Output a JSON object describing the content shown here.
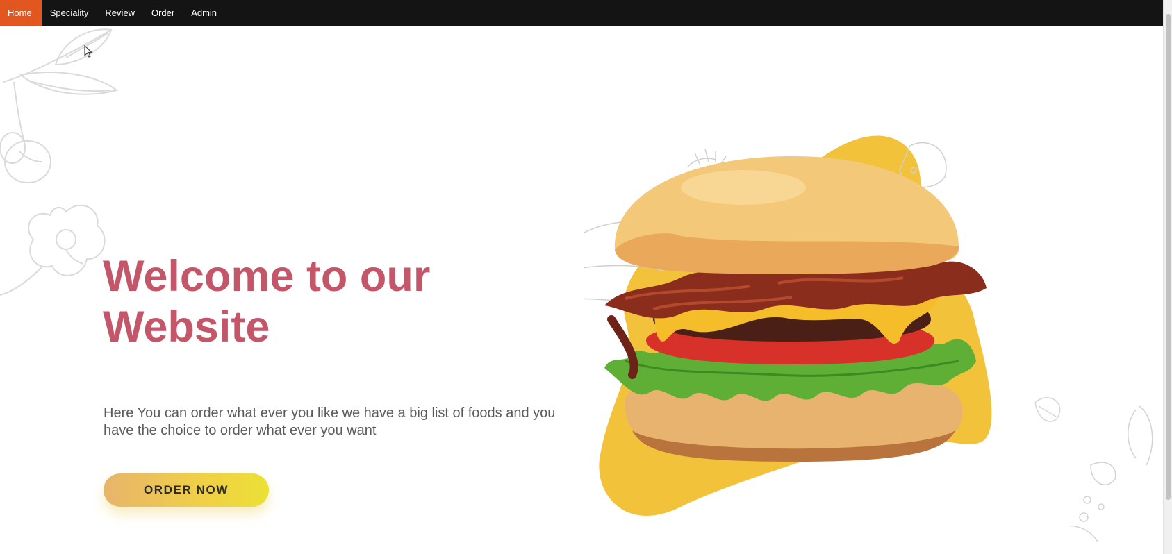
{
  "nav": {
    "items": [
      {
        "label": "Home",
        "active": true
      },
      {
        "label": "Speciality",
        "active": false
      },
      {
        "label": "Review",
        "active": false
      },
      {
        "label": "Order",
        "active": false
      },
      {
        "label": "Admin",
        "active": false
      }
    ]
  },
  "hero": {
    "title": "Welcome to our Website",
    "description": "Here You can order what ever you like we have a big list of foods and you have the choice to order what ever you want",
    "cta_label": "ORDER NOW"
  },
  "colors": {
    "nav_bg": "#141414",
    "nav_active": "#e2561f",
    "title": "#c4566a",
    "blob": "#f3c23b",
    "button_start": "#e7b46c",
    "button_end": "#ece035"
  },
  "icons": {
    "cursor": "mouse-pointer-icon",
    "burger": "burger-illustration",
    "doodles": [
      "leaf-branch-doodle",
      "flower-doodle",
      "food-sketch-doodle"
    ]
  }
}
